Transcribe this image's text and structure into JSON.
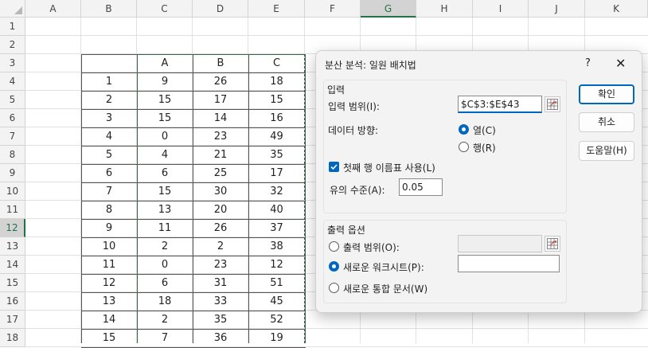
{
  "columns": [
    "A",
    "B",
    "C",
    "D",
    "E",
    "F",
    "G",
    "H",
    "I",
    "J",
    "K"
  ],
  "rows": [
    "1",
    "2",
    "3",
    "4",
    "5",
    "6",
    "7",
    "8",
    "9",
    "10",
    "11",
    "12",
    "13",
    "14",
    "15",
    "16",
    "17",
    "18"
  ],
  "table": {
    "headers": [
      "A",
      "B",
      "C"
    ],
    "index": [
      "1",
      "2",
      "3",
      "4",
      "5",
      "6",
      "7",
      "8",
      "9",
      "10",
      "11",
      "12",
      "13",
      "14",
      "15"
    ],
    "data": [
      [
        "9",
        "26",
        "18"
      ],
      [
        "15",
        "17",
        "15"
      ],
      [
        "15",
        "14",
        "16"
      ],
      [
        "0",
        "23",
        "49"
      ],
      [
        "4",
        "21",
        "35"
      ],
      [
        "6",
        "25",
        "17"
      ],
      [
        "15",
        "30",
        "32"
      ],
      [
        "13",
        "20",
        "40"
      ],
      [
        "11",
        "26",
        "37"
      ],
      [
        "2",
        "2",
        "38"
      ],
      [
        "0",
        "23",
        "12"
      ],
      [
        "6",
        "31",
        "51"
      ],
      [
        "18",
        "33",
        "45"
      ],
      [
        "2",
        "35",
        "52"
      ],
      [
        "7",
        "36",
        "19"
      ]
    ]
  },
  "dialog": {
    "title": "분산 분석: 일원 배치법",
    "help": "?",
    "close": "✕",
    "input_group": "입력",
    "input_range_label": "입력 범위(I):",
    "input_range_value": "$C$3:$E$43",
    "direction_label": "데이터 방향:",
    "direction_col": "열(C)",
    "direction_row": "행(R)",
    "first_row_label": "첫째 행 이름표 사용(L)",
    "alpha_label": "유의 수준(A):",
    "alpha_value": "0.05",
    "output_group": "출력 옵션",
    "output_range": "출력 범위(O):",
    "new_sheet": "새로운 워크시트(P):",
    "new_workbook": "새로운 통합 문서(W)",
    "ok": "확인",
    "cancel": "취소",
    "help_button": "도움말(H)"
  }
}
